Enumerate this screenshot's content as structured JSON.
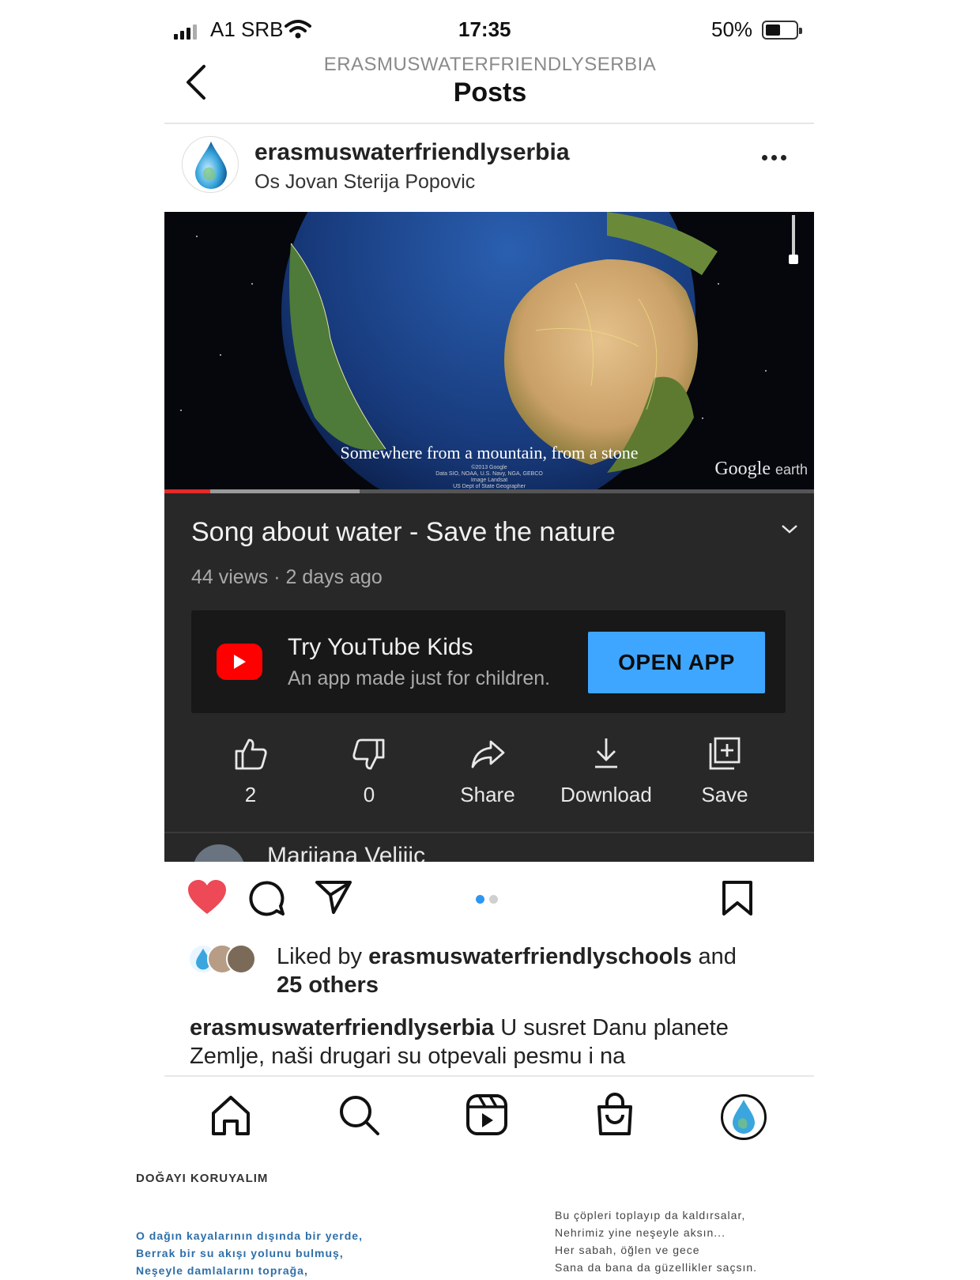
{
  "status_bar": {
    "carrier": "A1 SRB",
    "time": "17:35",
    "battery": "50%",
    "battery_level": 0.5
  },
  "header": {
    "username": "ERASMUSWATERFRIENDLYSERBIA",
    "title": "Posts"
  },
  "post": {
    "username": "erasmuswaterfriendlyserbia",
    "location": "Os Jovan Sterija Popovic",
    "video": {
      "subtitle": "Somewhere from a mountain, from a stone",
      "credits": [
        "©2013 Google",
        "Data SIO, NOAA, U.S. Navy, NGA, GEBCO",
        "Image Landsat",
        "US Dept of State Geographer"
      ],
      "watermark_brand": "Google",
      "watermark_product": "earth",
      "played_fraction": 0.07,
      "buffered_fraction": 0.3
    },
    "youtube": {
      "title": "Song about water -  Save the nature",
      "meta": "44 views · 2 days ago",
      "promo": {
        "title": "Try YouTube Kids",
        "subtitle": "An app made just for children.",
        "button": "OPEN APP"
      },
      "actions": [
        {
          "label": "2",
          "icon": "thumbs-up-icon"
        },
        {
          "label": "0",
          "icon": "thumbs-down-icon"
        },
        {
          "label": "Share",
          "icon": "share-icon"
        },
        {
          "label": "Download",
          "icon": "download-icon"
        },
        {
          "label": "Save",
          "icon": "save-playlist-icon"
        }
      ],
      "comment_peek": "Marijana Velijic"
    },
    "liked": true,
    "carousel": {
      "count": 2,
      "active": 1
    },
    "likes": {
      "prefix": "Liked by ",
      "user": "erasmuswaterfriendlyschools",
      "connector": " and",
      "others": "25 others"
    },
    "caption": {
      "user": "erasmuswaterfriendlyserbia",
      "text": " U susret Danu planete Zemlje, naši drugari su otpevali pesmu i na"
    }
  },
  "colors": {
    "like_red": "#ed4956",
    "youtube_red": "#ff0000",
    "open_app_blue": "#3ea6ff",
    "carousel_active": "#2f96f0",
    "youtube_panel": "#282828"
  },
  "tabbar": {
    "icons": [
      "home-icon",
      "search-icon",
      "reels-icon",
      "shop-icon",
      "profile-avatar"
    ]
  },
  "footer": {
    "heading": "DOĞAYI KORUYALIM",
    "poem_left": [
      "O dağın kayalarının dışında bir yerde,",
      "Berrak bir su akışı yolunu bulmuş,",
      "Neşeyle damlalarını toprağa,"
    ],
    "poem_right": [
      "Bu  çöpleri toplayıp da kaldırsalar,",
      "Nehrimiz yine neşeyle aksın...",
      "Her sabah, öğlen ve gece",
      "Sana da bana da güzellikler saçsın."
    ]
  }
}
